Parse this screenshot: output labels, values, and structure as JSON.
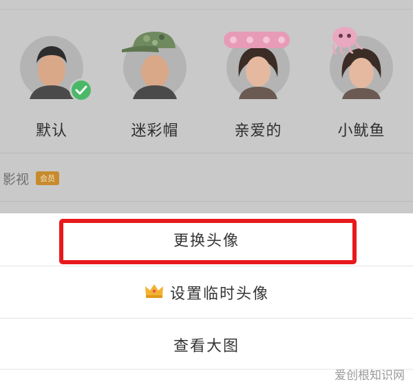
{
  "avatars": [
    {
      "label": "默认",
      "selected": true
    },
    {
      "label": "迷彩帽",
      "selected": false
    },
    {
      "label": "亲爱的",
      "selected": false
    },
    {
      "label": "小鱿鱼",
      "selected": false
    }
  ],
  "movie_row": {
    "label": "影视",
    "badge": "会员"
  },
  "sheet": {
    "change_avatar": "更换头像",
    "temp_avatar": "设置临时头像",
    "view_large": "查看大图"
  },
  "icons": {
    "selected_badge": "check-icon",
    "vip": "crown-icon"
  },
  "colors": {
    "highlight": "#e8191c",
    "check": "#4bb868",
    "vip_badge": "#c78b2e"
  },
  "watermark": "爱创根知识网"
}
